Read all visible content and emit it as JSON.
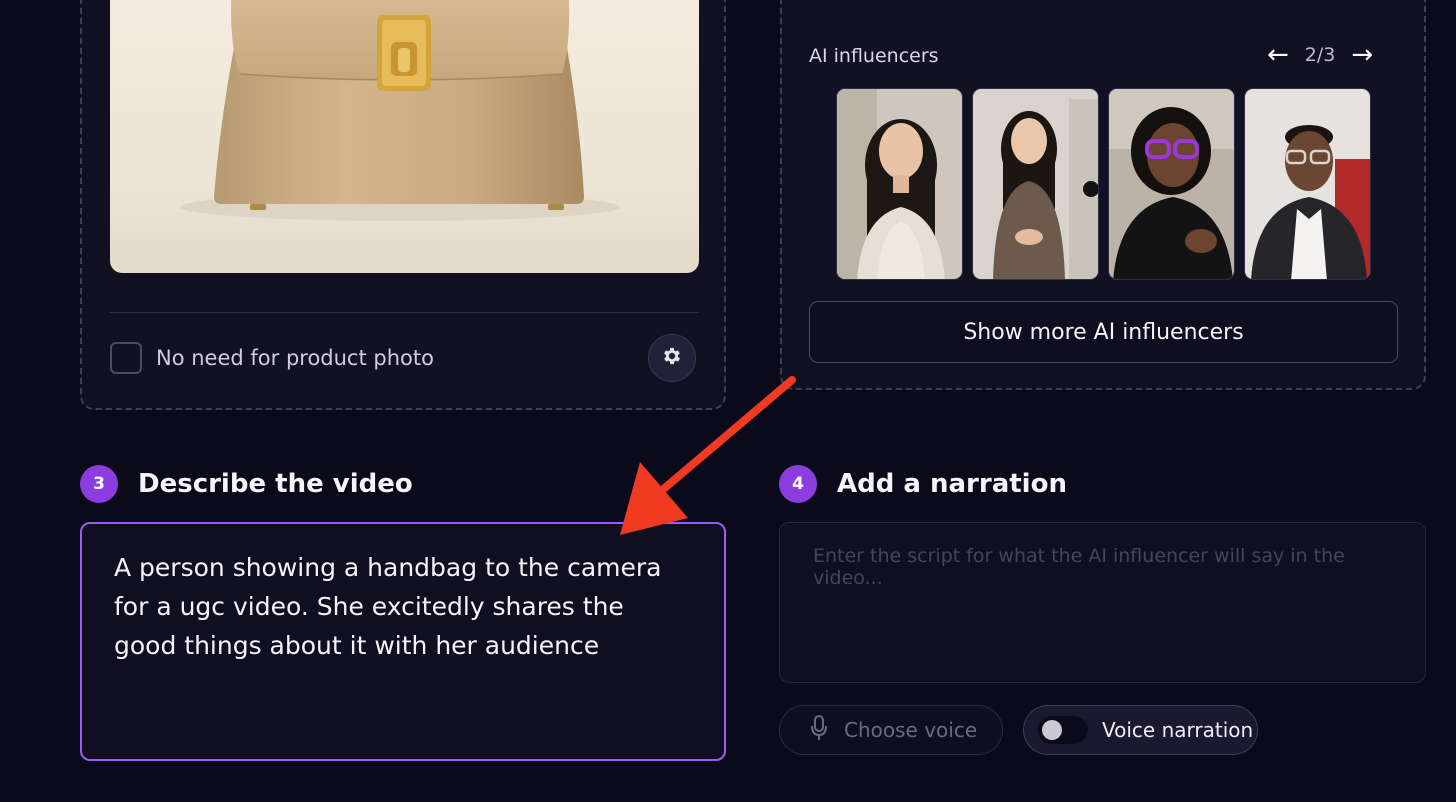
{
  "product": {
    "image_alt": "beige leather handbag with gold clasp",
    "no_photo_label": "No need for product photo"
  },
  "influencers": {
    "title": "AI influencers",
    "page": "2/3",
    "prev_icon": "arrow-left-icon",
    "next_icon": "arrow-right-icon",
    "thumbnails": [
      {
        "name": "influencer-1"
      },
      {
        "name": "influencer-2"
      },
      {
        "name": "influencer-3"
      },
      {
        "name": "influencer-4"
      }
    ],
    "show_more_label": "Show more AI influencers"
  },
  "describe": {
    "step": "3",
    "title": "Describe the video",
    "text": "A person showing a handbag to the camera for a ugc video. She excitedly shares the good things about it with her audience"
  },
  "narration": {
    "step": "4",
    "title": "Add a narration",
    "placeholder": "Enter the script for what the AI influencer will say in the video...",
    "choose_voice_label": "Choose voice",
    "voice_narration_label": "Voice narration",
    "voice_narration_enabled": false
  },
  "colors": {
    "background": "#0b0a1b",
    "accent": "#8b3ddf",
    "focus_border": "#9b5cf0",
    "annotation": "#f03a22"
  }
}
